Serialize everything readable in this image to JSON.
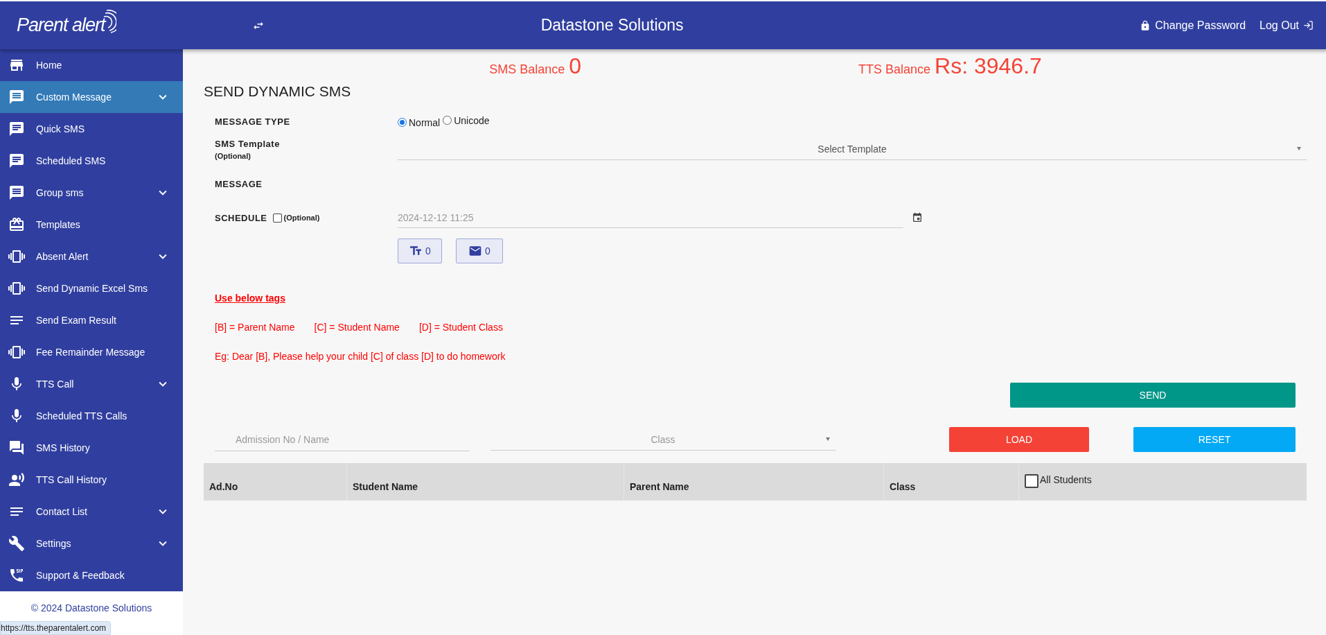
{
  "header": {
    "logo": "Parent alert",
    "title": "Datastone Solutions",
    "links": [
      {
        "kind": "password",
        "label": "Change Password"
      },
      {
        "kind": "logout",
        "label": "Log Out"
      }
    ]
  },
  "sidebar": {
    "items": [
      {
        "label": "Home",
        "selected": false,
        "has_submenu": false
      },
      {
        "label": "Custom Message",
        "selected": true,
        "has_submenu": true
      },
      {
        "label": "Quick SMS",
        "selected": false,
        "has_submenu": false
      },
      {
        "label": "Scheduled SMS",
        "selected": false,
        "has_submenu": false
      },
      {
        "label": "Group sms",
        "selected": false,
        "has_submenu": true
      },
      {
        "label": "Templates",
        "selected": false,
        "has_submenu": false
      },
      {
        "label": "Absent Alert",
        "selected": false,
        "has_submenu": true
      },
      {
        "label": "Send Dynamic Excel Sms",
        "selected": false,
        "has_submenu": false
      },
      {
        "label": "Send Exam Result",
        "selected": false,
        "has_submenu": false
      },
      {
        "label": "Fee Remainder Message",
        "selected": false,
        "has_submenu": false
      },
      {
        "label": "TTS Call",
        "selected": false,
        "has_submenu": true
      },
      {
        "label": "Scheduled TTS Calls",
        "selected": false,
        "has_submenu": false
      },
      {
        "label": "SMS History",
        "selected": false,
        "has_submenu": false
      },
      {
        "label": "TTS Call History",
        "selected": false,
        "has_submenu": false
      },
      {
        "label": "Contact List",
        "selected": false,
        "has_submenu": true
      },
      {
        "label": "Settings",
        "selected": false,
        "has_submenu": true
      },
      {
        "label": "Support & Feedback",
        "selected": false,
        "has_submenu": false
      }
    ],
    "footer": "© 2024 Datastone Solutions"
  },
  "balances": [
    {
      "label": "SMS Balance",
      "value": "0"
    },
    {
      "label": "TTS Balance",
      "value": "Rs: 3946.7"
    }
  ],
  "page_title": "SEND DYNAMIC SMS",
  "form": {
    "message_type": {
      "label": "MESSAGE TYPE",
      "options": [
        {
          "label": "Normal",
          "selected": true
        },
        {
          "label": "Unicode",
          "selected": false
        }
      ]
    },
    "template": {
      "label": "SMS Template",
      "hint": "(Optional)",
      "placeholder": "Select Template"
    },
    "message": {
      "label": "MESSAGE"
    },
    "schedule": {
      "label": "SCHEDULE",
      "checked": false,
      "hint": "(Optional)",
      "value": "2024-12-12 11:25"
    },
    "counters": [
      {
        "kind": "characters",
        "value": "0"
      },
      {
        "kind": "messages",
        "value": "0"
      }
    ]
  },
  "tags": {
    "heading": "Use below tags",
    "items": [
      "[B] = Parent Name",
      "[C] = Student Name",
      "[D] = Student Class"
    ],
    "example": "Eg: Dear [B], Please help your child [C] of class [D] to do homework"
  },
  "send_button": "SEND",
  "filters": {
    "search": {
      "placeholder": "Admission No / Name"
    },
    "class": {
      "placeholder": "Class"
    },
    "load_button": "LOAD",
    "reset_button": "RESET"
  },
  "table": {
    "columns": [
      "Ad.No",
      "Student Name",
      "Parent Name",
      "Class"
    ],
    "select_all": {
      "label": "All Students",
      "checked": false
    }
  },
  "status_bar": {
    "url": "https://tts.theparentalert.com"
  }
}
